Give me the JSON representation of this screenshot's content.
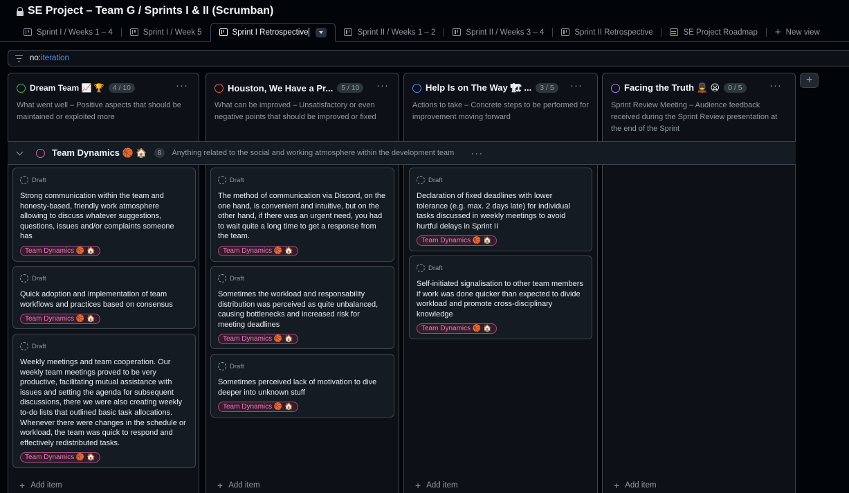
{
  "project": {
    "title": "SE Project – Team G / Sprints I & II (Scrumban)"
  },
  "tabs": [
    {
      "label": "Sprint I / Weeks 1 – 4",
      "icon": "board-icon"
    },
    {
      "label": "Sprint I / Week 5",
      "icon": "board-icon"
    },
    {
      "label": "Sprint I Retrospective",
      "icon": "board-icon",
      "active": true
    },
    {
      "label": "Sprint II / Weeks 1 – 2",
      "icon": "board-icon"
    },
    {
      "label": "Sprint II / Weeks 3 – 4",
      "icon": "board-icon"
    },
    {
      "label": "Sprint II Retrospective",
      "icon": "board-icon"
    },
    {
      "label": "SE Project Roadmap",
      "icon": "table-icon"
    }
  ],
  "new_view_label": "New view",
  "filter": {
    "key": "no:",
    "value": "iteration"
  },
  "columns": [
    {
      "name": "Dream Team 📈 🏆",
      "count": "4 / 10",
      "color": "#3fb950",
      "description": "What went well – Positive aspects that should be maintained or exploited more"
    },
    {
      "name": "Houston, We Have a Pr...",
      "count": "5 / 10",
      "color": "#f85149",
      "description": "What can be improved – Unsatisfactory or even negative points that should be improved or fixed"
    },
    {
      "name": "Help Is on The Way 🏗 ...",
      "count": "3 / 5",
      "color": "#4493f8",
      "description": "Actions to take – Concrete steps to be performed for improvement moving forward"
    },
    {
      "name": "Facing the Truth 💂 😦",
      "count": "0 / 5",
      "color": "#ab7df8",
      "description": "Sprint Review Meeting – Audience feedback received during the Sprint Review presentation at the end of the Sprint"
    }
  ],
  "group": {
    "name": "Team Dynamics 🏀 🏠",
    "count": "8",
    "description": "Anything related to the social and working atmosphere within the development team"
  },
  "draft_label": "Draft",
  "label_text": "Team Dynamics 🏀 🏠",
  "cards": {
    "col1": [
      "Strong communication within the team and honesty-based, friendly work atmosphere allowing to discuss whatever suggestions, questions, issues and/or complaints someone has",
      "Quick adoption and implementation of team workflows and practices based on consensus",
      "Weekly meetings and team cooperation. Our weekly team meetings proved to be very productive, facilitating mutual assistance with issues and setting the agenda for subsequent discussions, there we were also creating weekly to-do lists that outlined basic task allocations. Whenever there were changes in the schedule or workload, the team was quick to respond and effectively redistributed tasks."
    ],
    "col2": [
      "The method of communication via Discord, on the one hand, is convenient and intuitive, but on the other hand, if there was an urgent need, you had to wait quite a long time to get a response from the team.",
      "Sometimes the workload and responsability distribution was perceived as quite unbalanced, causing bottlenecks and increased risk for meeting deadlines",
      "Sometimes perceived lack of motivation to dive deeper into unknown stuff"
    ],
    "col3": [
      "Declaration of fixed deadlines with lower tolerance (e.g. max. 2 days late) for individual tasks discussed in weekly meetings to avoid hurtful delays in Sprint II",
      "Self-initiated signalisation to other team members if work was done quicker than expected to divide workload and promote cross-disciplinary knowledge"
    ]
  },
  "add_item_label": "Add item"
}
